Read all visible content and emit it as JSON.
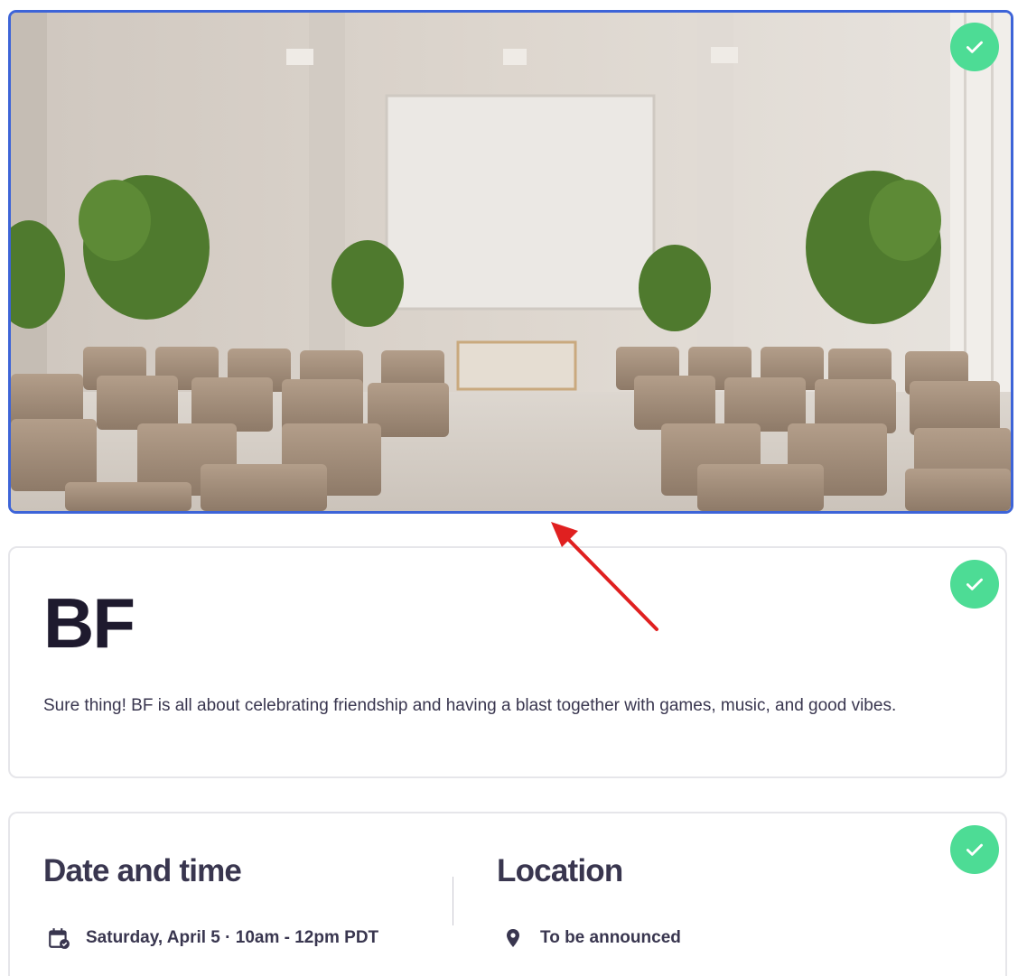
{
  "hero": {
    "image_description_icon": "conference-room-image",
    "status_icon": "check-icon"
  },
  "event": {
    "title": "BF",
    "summary": "Sure thing! BF is all about celebrating friendship and having a blast together with games, music, and good vibes.",
    "status_icon": "check-icon"
  },
  "details": {
    "date_heading": "Date and time",
    "date_value": "Saturday, April 5 · 10am - 12pm PDT",
    "date_icon": "calendar-check-icon",
    "location_heading": "Location",
    "location_value": "To be announced",
    "location_icon": "map-pin-icon",
    "status_icon": "check-icon"
  },
  "colors": {
    "accent_border": "#3d64d8",
    "success": "#4ddc95",
    "annotation_arrow": "#e02020",
    "text_dark": "#1e1a2e"
  }
}
